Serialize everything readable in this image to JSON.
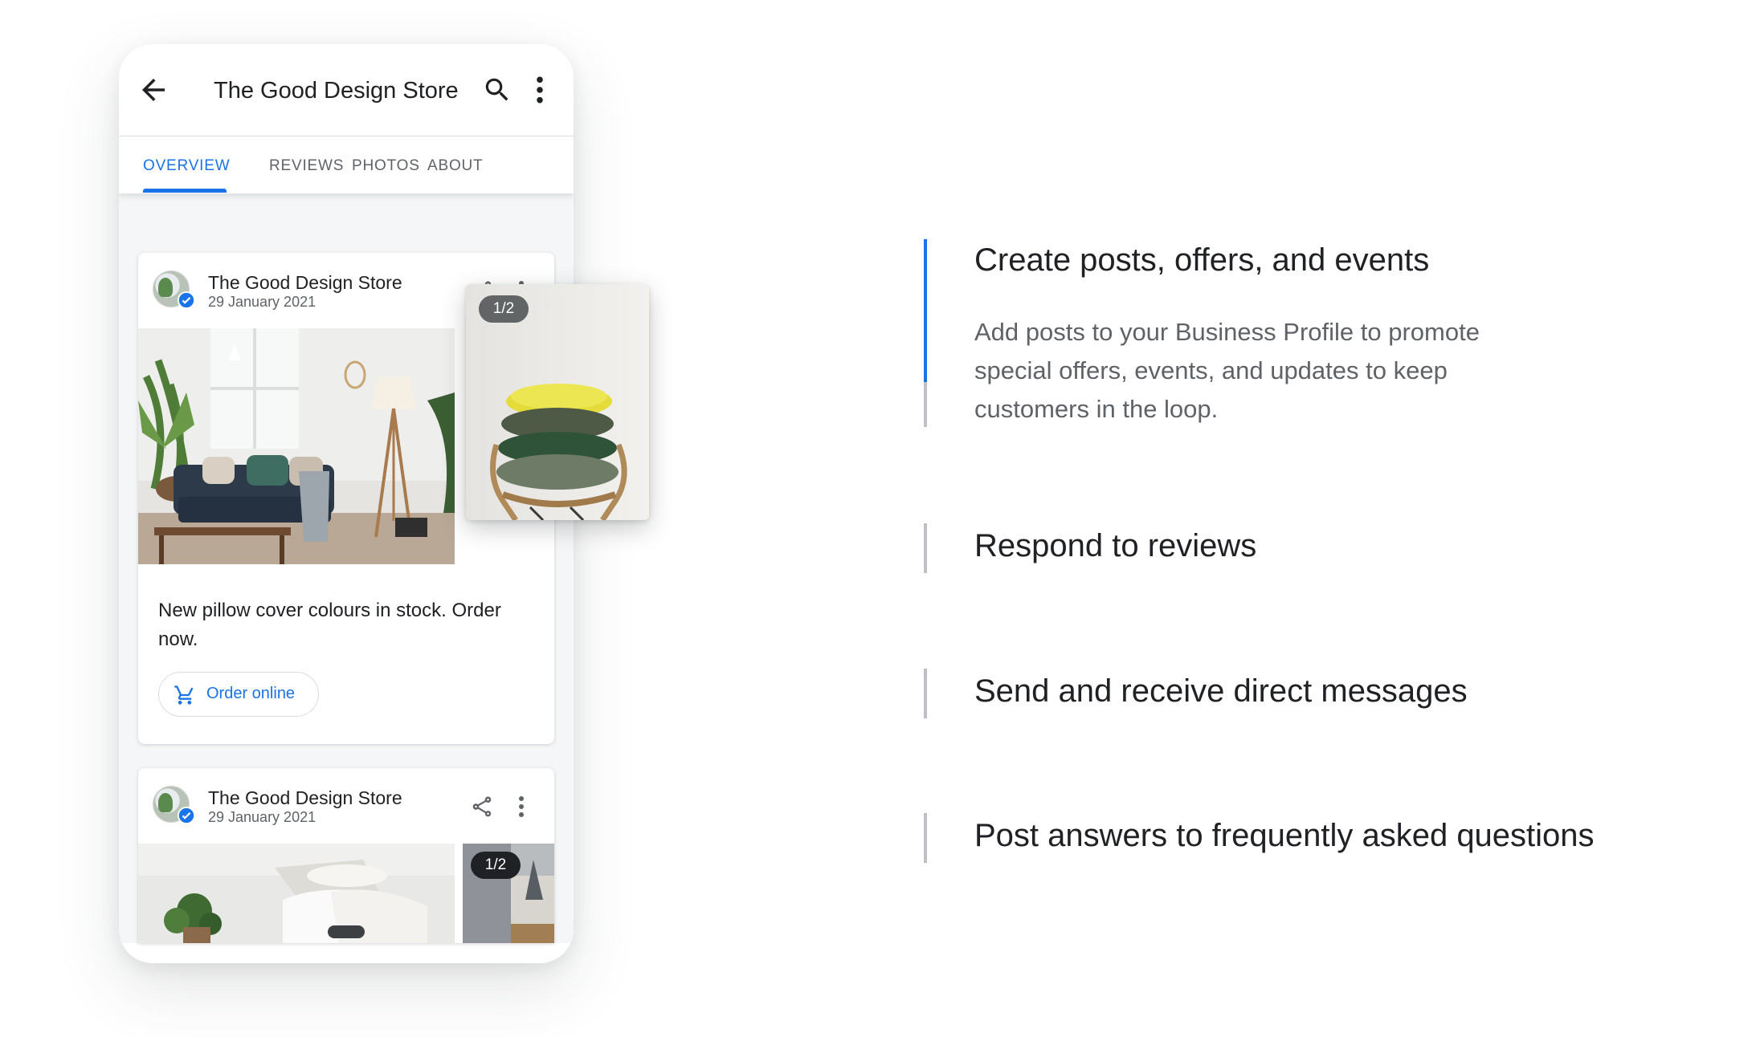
{
  "app": {
    "title": "The Good Design Store",
    "icons": {
      "back": "arrow-back-icon",
      "search": "search-icon",
      "more": "more-vert-icon"
    }
  },
  "tabs": [
    {
      "label": "OVERVIEW",
      "active": true
    },
    {
      "label": "REVIEWS",
      "active": false
    },
    {
      "label": "PHOTOS",
      "active": false
    },
    {
      "label": "ABOUT",
      "active": false
    }
  ],
  "posts": [
    {
      "store": "The Good Design Store",
      "date": "29 January 2021",
      "counter": "1/2",
      "text": "New pillow cover colours in stock. Order now.",
      "button": {
        "label": "Order online",
        "icon": "shopping-cart-icon"
      }
    },
    {
      "store": "The Good Design Store",
      "date": "29 January 2021",
      "counter": "1/2"
    }
  ],
  "features": [
    {
      "title": "Create posts, offers, and events",
      "description": "Add posts to your Business Profile to promote special offers, events, and updates to keep customers in the loop.",
      "active": true
    },
    {
      "title": "Respond to reviews",
      "active": false
    },
    {
      "title": "Send and receive direct messages",
      "active": false
    },
    {
      "title": "Post answers to frequently asked questions",
      "active": false
    }
  ],
  "colors": {
    "accent": "#1a73e8",
    "text_primary": "#202124",
    "text_secondary": "#5f6368",
    "divider": "#bdc1c6"
  }
}
